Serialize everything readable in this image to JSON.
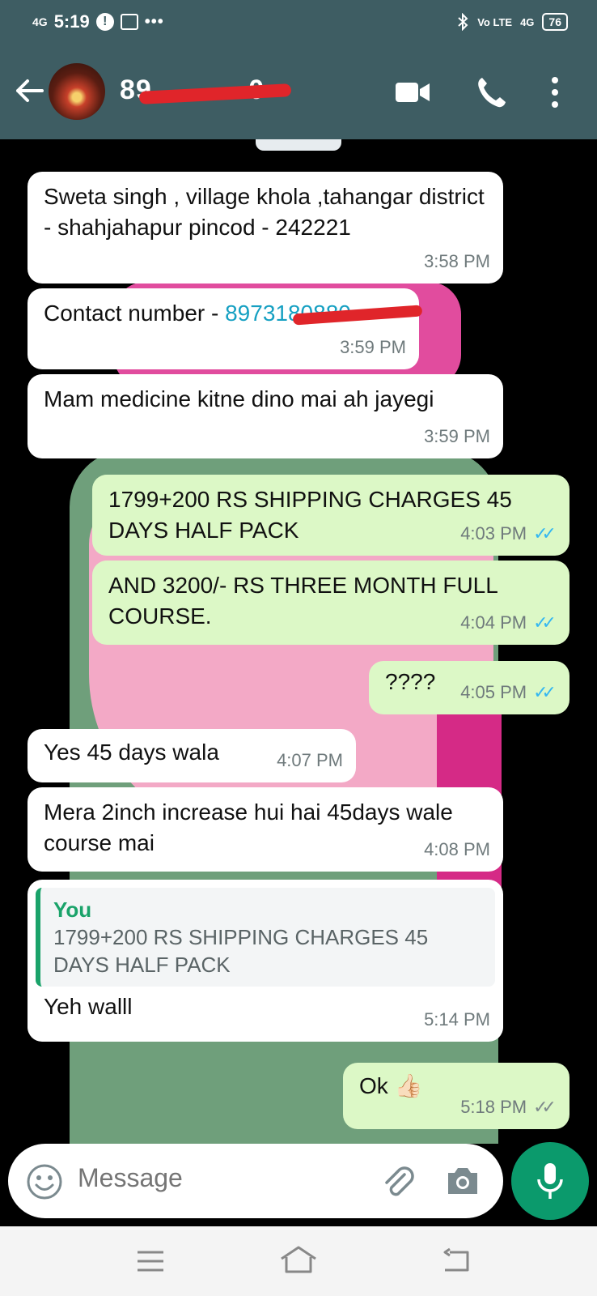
{
  "status_bar": {
    "time": "5:19",
    "signal": "4G",
    "alert_glyph": "!",
    "dots": "•••",
    "volte": "Vo LTE",
    "net": "4G",
    "battery": "76"
  },
  "header": {
    "contact": "8973180880",
    "contact_visible": "89",
    "contact_tail": "0"
  },
  "messages": [
    {
      "dir": "in",
      "text": "Sweta singh , village khola ,tahangar district - shahjahapur pincod - 242221",
      "time": "3:58 PM"
    },
    {
      "dir": "in",
      "prefix": "Contact number - ",
      "link": "8973180880",
      "time": "3:59 PM"
    },
    {
      "dir": "in",
      "text": "Mam medicine kitne dino mai ah jayegi",
      "time": "3:59 PM"
    },
    {
      "dir": "out",
      "text": "1799+200 RS SHIPPING CHARGES 45 DAYS HALF PACK",
      "time": "4:03 PM",
      "status": "read"
    },
    {
      "dir": "out",
      "text": "AND 3200/- RS THREE MONTH FULL COURSE.",
      "time": "4:04 PM",
      "status": "read"
    },
    {
      "dir": "out",
      "text": "????",
      "time": "4:05 PM",
      "status": "read"
    },
    {
      "dir": "in",
      "text": "Yes 45 days wala",
      "time": "4:07 PM"
    },
    {
      "dir": "in",
      "text": "Mera 2inch increase hui hai 45days wale course mai",
      "time": "4:08 PM"
    },
    {
      "dir": "in",
      "quote": {
        "author": "You",
        "text": "1799+200 RS SHIPPING CHARGES 45 DAYS HALF PACK"
      },
      "text": "Yeh walll",
      "time": "5:14 PM"
    },
    {
      "dir": "out",
      "text": "Ok 👍🏻",
      "time": "5:18 PM",
      "status": "delivered"
    }
  ],
  "input": {
    "placeholder": "Message"
  },
  "colors": {
    "header": "#3e5d63",
    "outgoing": "#dcf8c6",
    "incoming": "#ffffff",
    "accent": "#0b9a6c",
    "read_ticks": "#34b7f1"
  }
}
